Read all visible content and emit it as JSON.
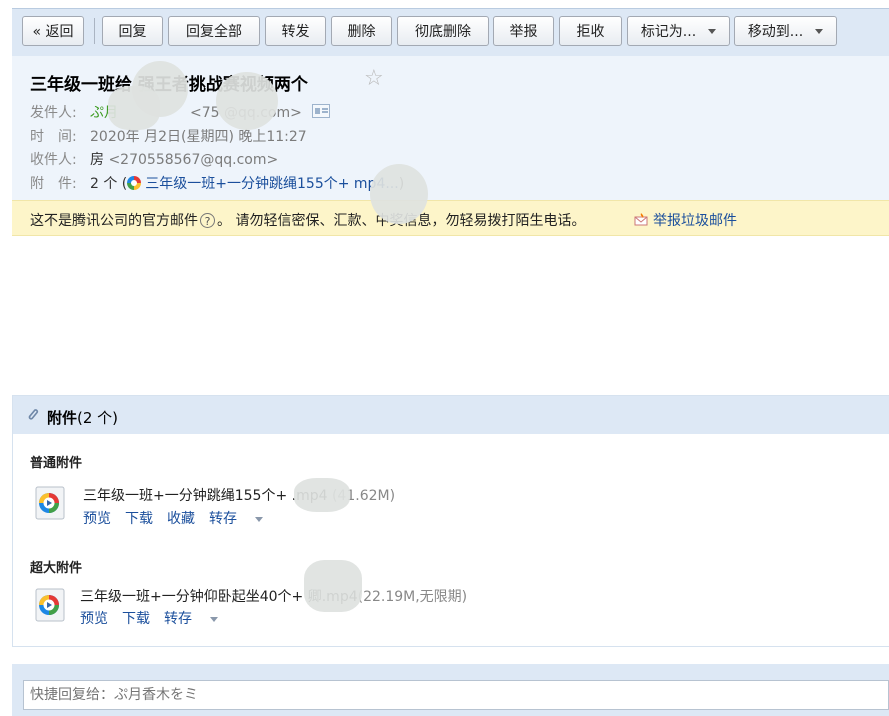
{
  "toolbar": {
    "back": "« 返回",
    "reply": "回复",
    "reply_all": "回复全部",
    "forward": "转发",
    "delete": "删除",
    "delete_forever": "彻底删除",
    "report": "举报",
    "reject": "拒收",
    "mark_as": "标记为...",
    "move_to": "移动到..."
  },
  "mail": {
    "subject": "三年级一班给       强王者挑战赛视频两个",
    "sender_label": "发件人:",
    "sender_name": "ぷ月",
    "sender_email": "<75          @qq.com>",
    "time_label": "时　间:",
    "time_value": "2020年 月2日(星期四) 晚上11:27",
    "recipient_label": "收件人:",
    "recipient_name": "房",
    "recipient_email": "<270558567@qq.com>",
    "attach_label": "附　件:",
    "attach_count": "2 个 (",
    "attach_preview": "三年级一班+一分钟跳绳155个+     mp4...",
    "attach_close": ")"
  },
  "warning": {
    "part1": "这不是腾讯公司的官方邮件",
    "part2": "。  请勿轻信密保、汇款、中奖信息，勿轻易拨打陌生电话。",
    "report_label": "举报垃圾邮件"
  },
  "attachments": {
    "title": "附件",
    "count": "(2 个)",
    "normal_title": "普通附件",
    "normal_file": {
      "name": "三年级一班+一分钟跳绳155个+       .mp4",
      "meta": "(41.62M)",
      "actions": [
        "预览",
        "下载",
        "收藏",
        "转存"
      ]
    },
    "large_title": "超大附件",
    "large_file": {
      "name": "三年级一班+一分钟仰卧起坐40个+    卿.mp4",
      "meta": "(22.19M,无限期)",
      "actions": [
        "预览",
        "下载",
        "转存"
      ]
    }
  },
  "quick_reply": {
    "placeholder": "快捷回复给：ぷ月香木をミ"
  },
  "colors": {
    "toolbar_bg": "#dde8f5",
    "header_bg": "#eef4fb",
    "warning_bg": "#fdf5c9",
    "link": "#1b4f9c",
    "sender_name": "#3a9a1e"
  }
}
